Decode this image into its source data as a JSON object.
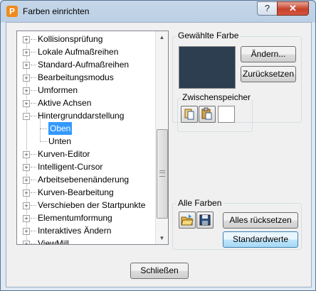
{
  "window": {
    "title": "Farben einrichten",
    "app_icon": "P",
    "help_label": "?",
    "close_label": "✕"
  },
  "tree": {
    "items": [
      {
        "label": "Kollisionsprüfung"
      },
      {
        "label": "Lokale Aufmaßreihen"
      },
      {
        "label": "Standard-Aufmaßreihen"
      },
      {
        "label": "Bearbeitungsmodus"
      },
      {
        "label": "Umformen"
      },
      {
        "label": "Aktive Achsen"
      },
      {
        "label": "Hintergrunddarstellung",
        "expanded": true
      },
      {
        "label": "Oben",
        "child": true,
        "selected": true
      },
      {
        "label": "Unten",
        "child": true
      },
      {
        "label": "Kurven-Editor"
      },
      {
        "label": "Intelligent-Cursor"
      },
      {
        "label": "Arbeitsebenenänderung"
      },
      {
        "label": "Kurven-Bearbeitung"
      },
      {
        "label": "Verschieben der Startpunkte"
      },
      {
        "label": "Elementumformung"
      },
      {
        "label": "Interaktives Ändern"
      },
      {
        "label": "ViewMill"
      }
    ]
  },
  "selected_color": {
    "label": "Gewählte Farbe",
    "swatch_color": "#2c3e50",
    "change_label": "Ändern...",
    "reset_label": "Zurücksetzen"
  },
  "clipboard": {
    "label": "Zwischenspeicher",
    "copy_icon": "copy-icon",
    "paste_icon": "paste-icon",
    "slot_color": "#ffffff"
  },
  "all_colors": {
    "label": "Alle Farben",
    "open_icon": "folder-open-icon",
    "save_icon": "save-icon",
    "reset_all_label": "Alles rücksetzen",
    "defaults_label": "Standardwerte"
  },
  "footer": {
    "close_label": "Schließen"
  }
}
